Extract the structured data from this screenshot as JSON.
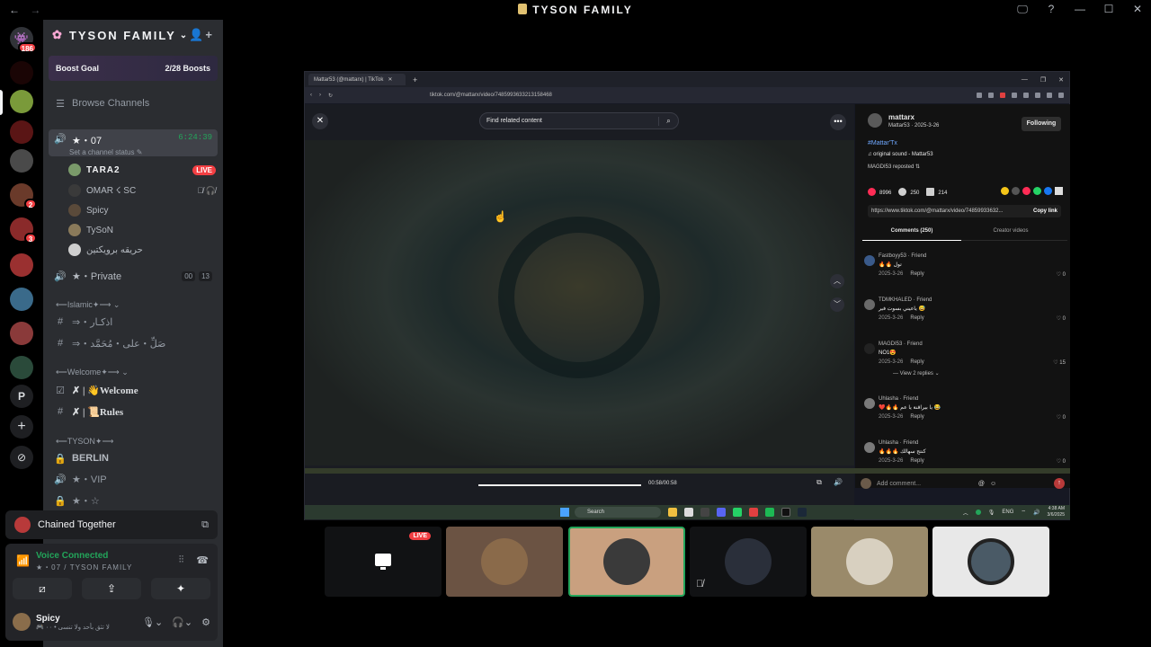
{
  "window": {
    "title": "TYSON FAMILY",
    "back": "←",
    "forward": "→",
    "controls": [
      "🖵",
      "?",
      "—",
      "☐",
      "✕"
    ]
  },
  "rail": {
    "dm_badge": "186",
    "badges": [
      "2",
      "3"
    ],
    "add_server": "+",
    "discover": "⊘",
    "p_label": "P"
  },
  "guild": {
    "name": "TYSON FAMILY",
    "boost_label": "Boost Goal",
    "boost_count": "2/28 Boosts"
  },
  "browse_channels": "Browse Channels",
  "voice_channel": {
    "name": "★・07",
    "timer": "6:24:39",
    "status_placeholder": "Set a channel status ✎",
    "members": [
      {
        "name": "TARA2",
        "live": "LIVE"
      },
      {
        "name": "OMAR ☇ SC",
        "live": ""
      },
      {
        "name": "Spicy",
        "live": ""
      },
      {
        "name": "TySoN",
        "live": ""
      },
      {
        "name": "حريقه برويكتين",
        "live": ""
      }
    ]
  },
  "private_channel": {
    "name": "★・Private",
    "count_a": "00",
    "count_b": "13"
  },
  "channels": [
    {
      "type": "category",
      "label": "⟵Islamic✦⟶ ⌄"
    },
    {
      "type": "text",
      "label": "⇒・اذكـار"
    },
    {
      "type": "text",
      "label": "⇒・صَلِّ・على・مُحَمَّد"
    },
    {
      "type": "category",
      "label": "⟵Welcome✦⟶ ⌄"
    },
    {
      "type": "rules",
      "label": "✗ | 👋Welcome"
    },
    {
      "type": "text",
      "label": "✗ | 📜Rules"
    },
    {
      "type": "category",
      "label": "⟵TYSON✦⟶"
    },
    {
      "type": "locked",
      "label": "BERLIN"
    },
    {
      "type": "voice",
      "label": "★・VIP"
    },
    {
      "type": "locked",
      "label": "★・☆"
    }
  ],
  "activity": {
    "title": "Chained Together"
  },
  "voice_panel": {
    "status": "Voice Connected",
    "channel": "★・07 / TYSON FAMILY"
  },
  "user": {
    "name": "Spicy",
    "status": "🎮 لا تثق بأحد ولا تنسى • ٠٠"
  },
  "browser": {
    "tab_title": "Mattar53 (@mattarx) | TikTok",
    "url": "tiktok.com/@mattarx/video/7485993633213158468",
    "search_placeholder": "Find related content",
    "time": "00:58/00:58",
    "author": {
      "name": "mattarx",
      "sub": "Mattar53 · 2025-3-26",
      "follow": "Following"
    },
    "hashtag": "#Mattar'Tx",
    "sound": "♫ original sound - Mattar53",
    "repost": "MAGDI53 reposted ⇅",
    "likes": "8996",
    "comments_count": "250",
    "saves": "214",
    "link": "https://www.tiktok.com/@mattarx/video/74859933632...",
    "copy_link": "Copy link",
    "tab_comments": "Comments (250)",
    "tab_creator": "Creator videos",
    "comments": [
      {
        "name": "Fastboyy53 · Friend",
        "text": "🔥🔥 تول",
        "date": "2025-3-26",
        "reply": "Reply",
        "likes": "♡ 0",
        "view_replies": ""
      },
      {
        "name": "TDMKHALED · Friend",
        "text": "ياعيني بسوت فير 😅",
        "date": "2025-3-26",
        "reply": "Reply",
        "likes": "♡ 0",
        "view_replies": ""
      },
      {
        "name": "MAGDI53 · Friend",
        "text": "NO1😍",
        "date": "2025-3-26",
        "reply": "Reply",
        "likes": "♡ 15",
        "view_replies": "— View 2 replies ⌄"
      },
      {
        "name": "Uhlasha · Friend",
        "text": "❤️🔥🔥 يا بيراقنة يا عم 😂",
        "date": "2025-3-26",
        "reply": "Reply",
        "likes": "♡ 0",
        "view_replies": ""
      },
      {
        "name": "Uhlasha · Friend",
        "text": "🔥🔥🔥 كنتج سهالك",
        "date": "2025-3-26",
        "reply": "Reply",
        "likes": "♡ 0",
        "view_replies": ""
      }
    ],
    "add_comment": "Add comment...",
    "taskbar_search": "Search",
    "clock_time": "4:38 AM",
    "clock_date": "3/6/2025",
    "lang": "ENG"
  },
  "tiles": {
    "live": "LIVE"
  },
  "colors": {
    "accent": "#23a55a",
    "danger": "#f23f43",
    "sidebar": "#2b2d31",
    "highlight_tile": "#c9a07f"
  }
}
